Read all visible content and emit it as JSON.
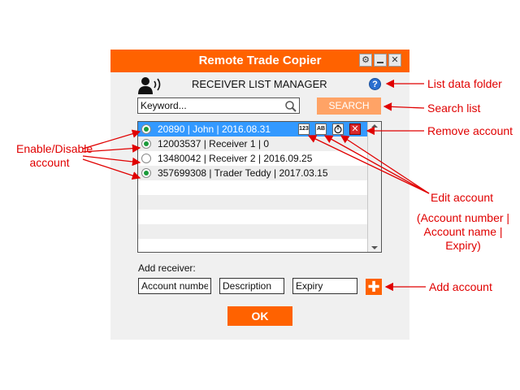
{
  "window": {
    "title": "Remote Trade Copier",
    "header_title": "RECEIVER LIST MANAGER"
  },
  "icons": {
    "header": "receiver-signal-icon",
    "help": "help-icon",
    "help_glyph": "?",
    "gear": "gear-icon",
    "minimize": "minimize-icon",
    "close": "close-icon",
    "search": "magnifier-icon",
    "add": "plus-icon"
  },
  "search": {
    "placeholder": "Keyword...",
    "button_label": "SEARCH"
  },
  "receivers": [
    {
      "enabled": true,
      "selected": true,
      "text": "20890 | John | 2016.08.31"
    },
    {
      "enabled": true,
      "selected": false,
      "text": "12003537 | Receiver 1 | 0"
    },
    {
      "enabled": false,
      "selected": false,
      "text": "13480042 | Receiver 2 | 2016.09.25"
    },
    {
      "enabled": true,
      "selected": false,
      "text": "357699308 | Trader Teddy | 2017.03.15"
    }
  ],
  "row_actions": {
    "account_number": "123",
    "account_name": "AB",
    "expiry": "expiry-clock-icon",
    "remove": "remove-icon",
    "remove_glyph": "✕"
  },
  "add_receiver": {
    "label": "Add receiver:",
    "account_placeholder": "Account number",
    "description_placeholder": "Description",
    "expiry_placeholder": "Expiry",
    "add_glyph": "✚"
  },
  "ok_label": "OK",
  "annotations": {
    "list_data_folder": "List data folder",
    "search_list": "Search list",
    "remove_account": "Remove account",
    "enable_disable_1": "Enable/Disable",
    "enable_disable_2": "account",
    "edit_account": "Edit account",
    "edit_detail_1": "(Account number |",
    "edit_detail_2": "Account name |",
    "edit_detail_3": "Expiry)",
    "add_account": "Add account"
  },
  "colors": {
    "accent": "#ff6200",
    "selection": "#3399ff",
    "annotation": "#e00000",
    "enabled_dot": "#1a9a3a"
  }
}
